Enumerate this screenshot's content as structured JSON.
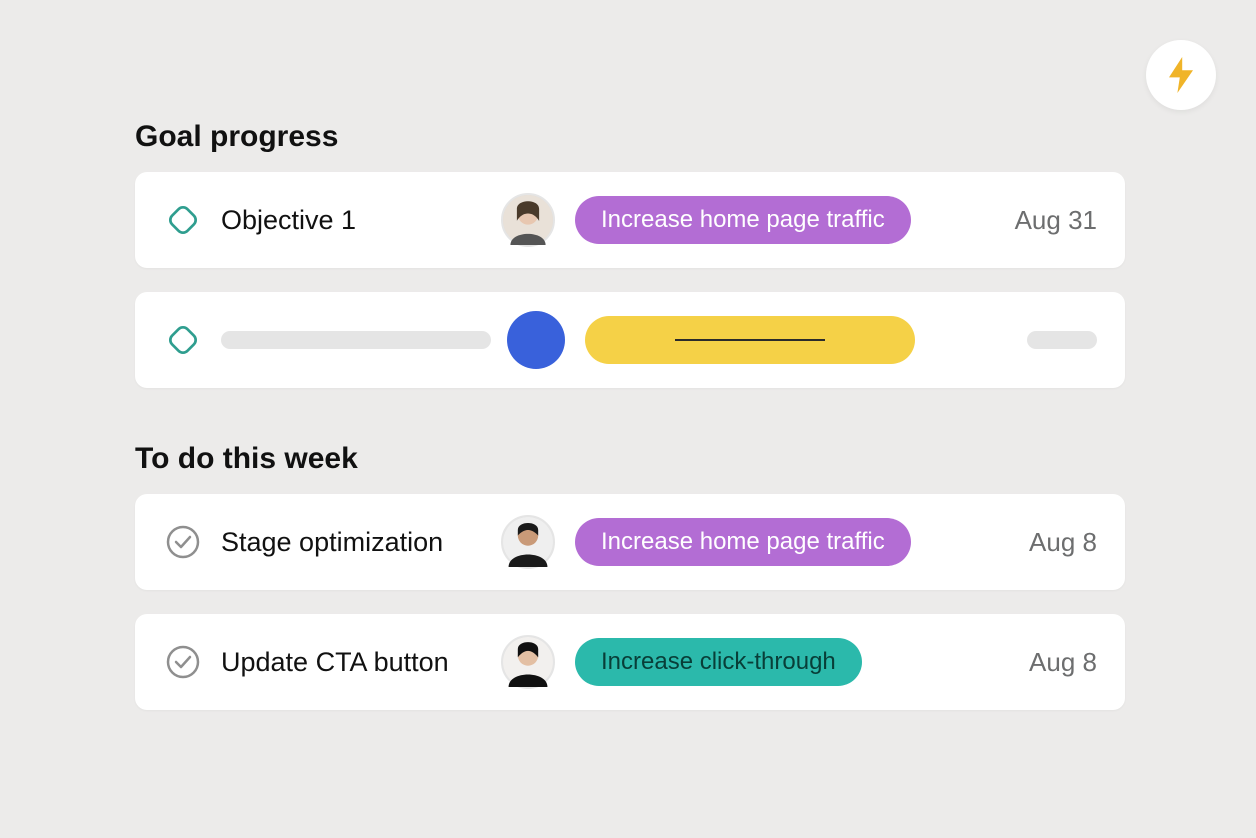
{
  "colors": {
    "purple": "#b36dd4",
    "teal": "#2bb9ab",
    "yellow": "#f5d147",
    "blue": "#3961db",
    "goalOutline": "#2f9e8f",
    "checkOutline": "#8f8f8f"
  },
  "sections": {
    "goals": {
      "title": "Goal progress",
      "items": [
        {
          "title": "Objective 1",
          "tag": "Increase home page traffic",
          "tagColor": "purple",
          "date": "Aug 31"
        }
      ]
    },
    "todo": {
      "title": "To do this week",
      "items": [
        {
          "title": "Stage optimization",
          "tag": "Increase home page traffic",
          "tagColor": "purple",
          "date": "Aug 8"
        },
        {
          "title": "Update CTA button",
          "tag": "Increase click-through",
          "tagColor": "teal",
          "date": "Aug 8"
        }
      ]
    }
  }
}
